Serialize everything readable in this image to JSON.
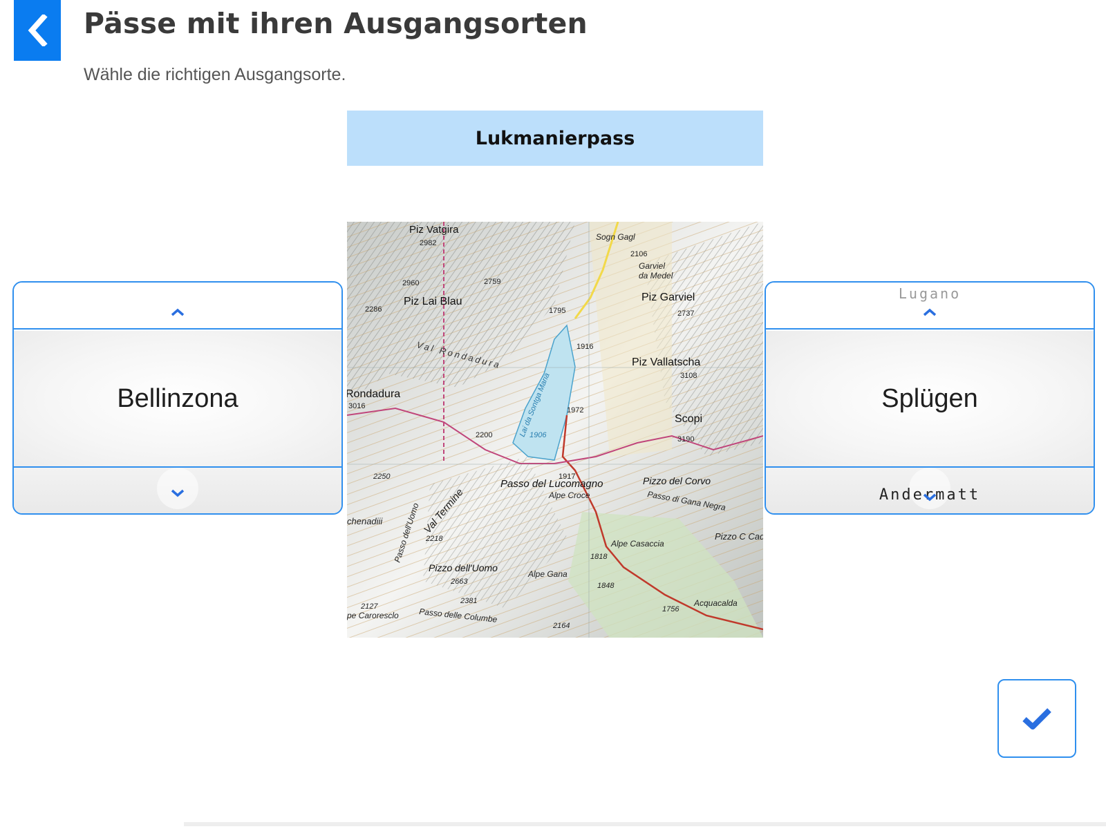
{
  "header": {
    "back_icon": "chevron-left-icon",
    "title": "Pässe mit ihren Ausgangsorten",
    "subtitle": "Wähle die richtigen Ausgangsorte."
  },
  "pass": {
    "name": "Lukmanierpass"
  },
  "map": {
    "labels": {
      "piz_vatgira": "Piz Vatgira",
      "e2982": "2982",
      "sogn_gagl": "Sogn Gagl",
      "e2106": "2106",
      "garviel": "Garviel",
      "da_medel": "da Medel",
      "e2960": "2960",
      "e2759": "2759",
      "piz_lai_blau": "Piz Lai Blau",
      "piz_garviel": "Piz Garviel",
      "e2286": "2286",
      "e1795": "1795",
      "e2737": "2737",
      "val_rondadura": "Val Rondadura",
      "e1916": "1916",
      "piz_vallatscha": "Piz Vallatscha",
      "e3108": "3108",
      "rondadura": "Rondadura",
      "e3016": "3016",
      "lake": "Lai da Sontga Maria",
      "e1972": "1972",
      "scopi": "Scopi",
      "e1906": "1906",
      "e2200": "2200",
      "e3190": "3190",
      "e2250": "2250",
      "e1917": "1917",
      "passo_del_lucomagno": "Passo del Lucomagno",
      "pizzo_del_corvo": "Pizzo del Corvo",
      "alpe_croce": "Alpe Croce",
      "passo_di_gana_negra": "Passo di Gana Negra",
      "val_termine": "Val Termine",
      "passo_dell_uomo": "Passo dell'Uomo",
      "chenadiii": "chenadiii",
      "e2218": "2218",
      "alpe_casaccia": "Alpe Casaccia",
      "pizzo_cadreig": "Pizzo C Cadreig",
      "e1818": "1818",
      "pizzo_dell_uomo": "Pizzo dell'Uomo",
      "e2663": "2663",
      "alpe_gana": "Alpe Gana",
      "e1848": "1848",
      "e2127": "2127",
      "caroresclo": "pe Caroresclo",
      "e2381": "2381",
      "passo_delle_columbe": "Passo delle Columbe",
      "e1756": "1756",
      "acquacalda": "Acquacalda",
      "e2164": "2164"
    }
  },
  "left_picker": {
    "up_icon": "chevron-up-icon",
    "current": "Bellinzona",
    "down_icon": "chevron-down-icon"
  },
  "right_picker": {
    "previous": "Lugano",
    "up_icon": "chevron-up-icon",
    "current": "Splügen",
    "next": "Andermatt",
    "down_icon": "chevron-down-icon"
  },
  "submit": {
    "icon": "checkmark-icon",
    "color": "#2a6fe0"
  },
  "colors": {
    "accent": "#0a7cf0",
    "border": "#2f8fee",
    "pass_bg": "#bcdffb"
  }
}
